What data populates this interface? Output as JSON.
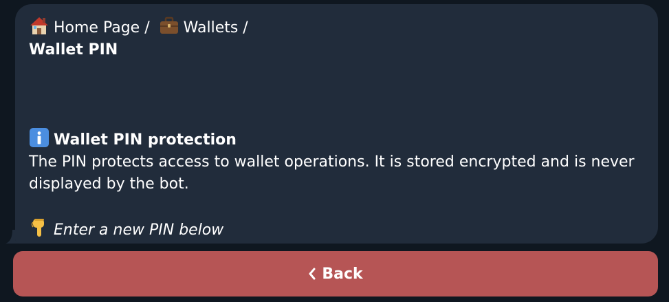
{
  "breadcrumb": {
    "home_label": "Home Page /",
    "home_icon": "house-icon",
    "wallets_label": "Wallets /",
    "wallets_icon": "briefcase-icon",
    "current": "Wallet PIN"
  },
  "info": {
    "icon": "info-icon",
    "heading": "Wallet PIN protection",
    "body": "The PIN protects access to wallet operations. It is stored encrypted and is never displayed by the bot."
  },
  "prompt": {
    "icon": "pointing-down-icon",
    "text": "Enter a new PIN below"
  },
  "keyboard": {
    "back_label": "Back",
    "back_icon": "chevron-left-icon",
    "back_color": "#b65555"
  },
  "colors": {
    "background": "#0f1720",
    "bubble": "#212c3b",
    "text": "#ffffff"
  }
}
